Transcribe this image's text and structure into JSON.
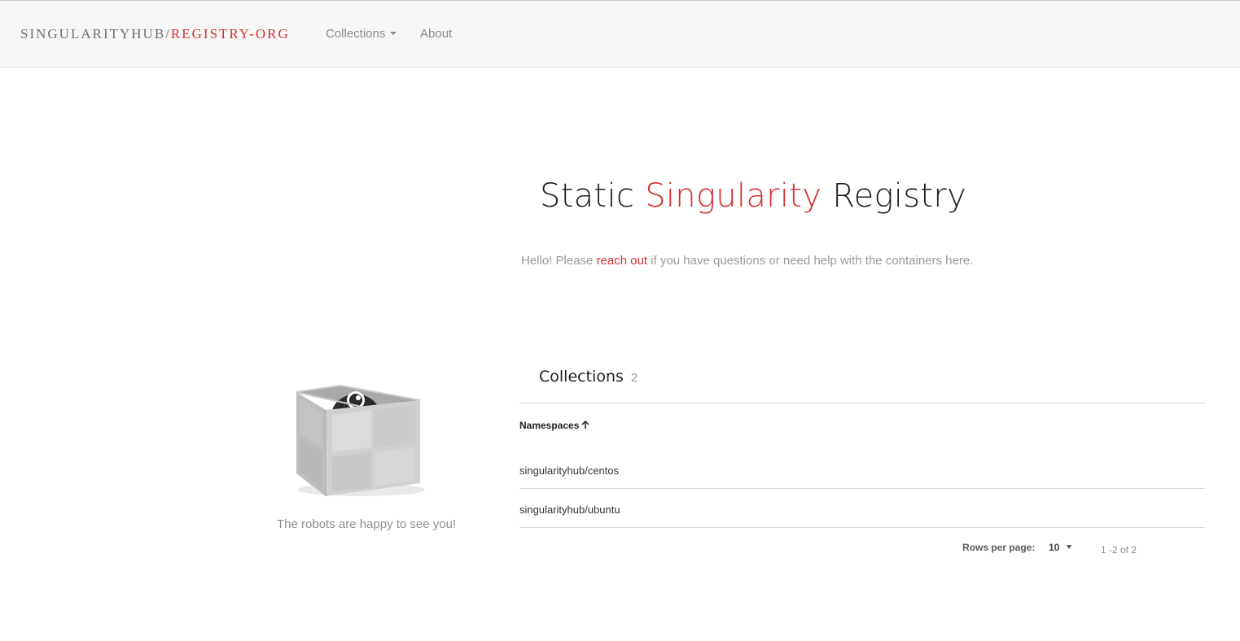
{
  "navbar": {
    "brand_prefix": "SINGULARITYHUB",
    "brand_slash": "/",
    "brand_suffix": "REGISTRY-ORG",
    "collections_label": "Collections",
    "about_label": "About"
  },
  "hero": {
    "title_part1": "Static ",
    "title_accent": "Singularity",
    "title_part2": " Registry"
  },
  "intro": {
    "before": "Hello! Please ",
    "link": "reach out",
    "after": " if you have questions or need help with the containers here."
  },
  "robot": {
    "caption": "The robots are happy to see you!"
  },
  "collections": {
    "label": "Collections",
    "count": "2",
    "column_header": "Namespaces",
    "rows": [
      "singularityhub/centos",
      "singularityhub/ubuntu"
    ]
  },
  "pagination": {
    "rows_per_page_label": "Rows per page:",
    "rows_per_page_value": "10",
    "range": "1 -2 of 2"
  },
  "colors": {
    "accent": "#d62f2f",
    "navbar_bg": "#f7f7f7"
  },
  "icons": [
    "chevron-down-icon",
    "arrow-up-icon",
    "robot-box-illustration",
    "dropdown-triangle-icon"
  ]
}
